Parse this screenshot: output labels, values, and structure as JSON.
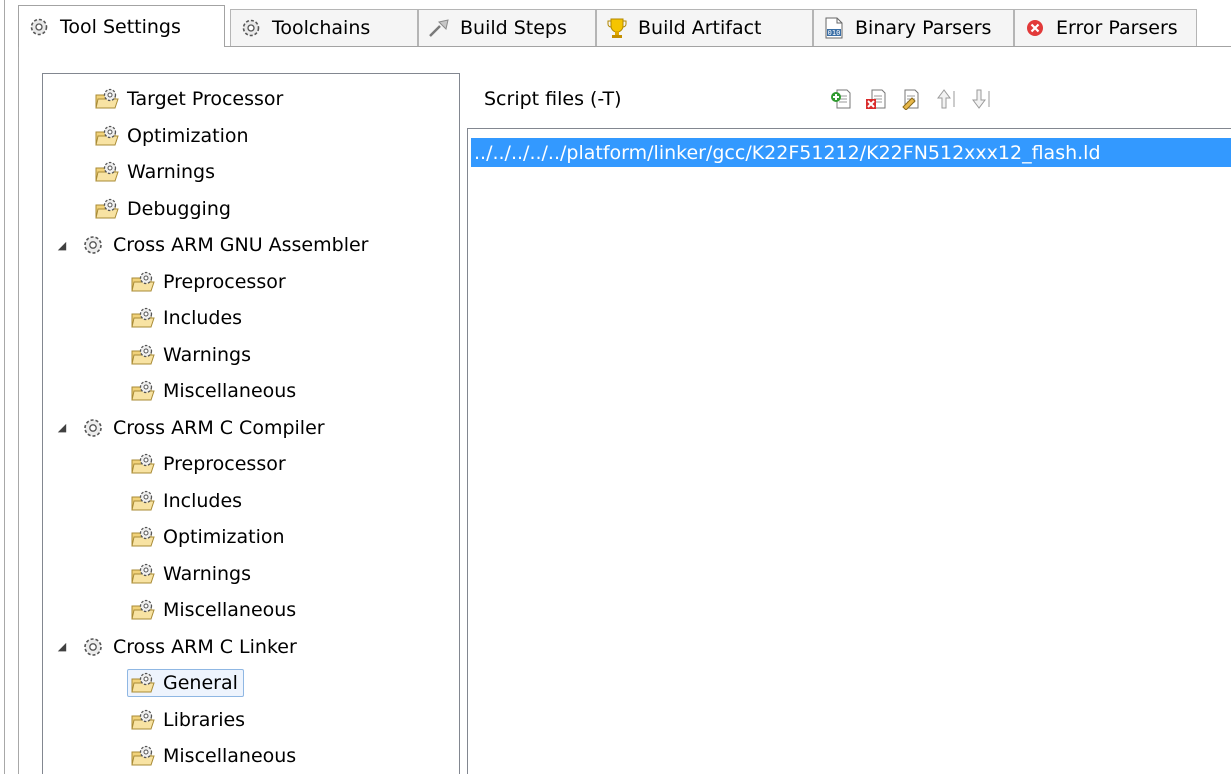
{
  "tabs": [
    {
      "label": "Tool Settings",
      "icon": "gear-icon",
      "active": true
    },
    {
      "label": "Toolchains",
      "icon": "gear-icon",
      "active": false
    },
    {
      "label": "Build Steps",
      "icon": "build-steps-icon",
      "active": false
    },
    {
      "label": "Build Artifact",
      "icon": "trophy-icon",
      "active": false
    },
    {
      "label": "Binary Parsers",
      "icon": "binary-file-icon",
      "active": false
    },
    {
      "label": "Error Parsers",
      "icon": "error-icon",
      "active": false
    }
  ],
  "tree": {
    "items": [
      {
        "label": "Target Processor",
        "icon": "option-folder-icon"
      },
      {
        "label": "Optimization",
        "icon": "option-folder-icon"
      },
      {
        "label": "Warnings",
        "icon": "option-folder-icon"
      },
      {
        "label": "Debugging",
        "icon": "option-folder-icon"
      },
      {
        "label": "Cross ARM GNU Assembler",
        "icon": "tool-gear-icon",
        "expanded": true
      },
      {
        "label": "Preprocessor",
        "icon": "option-folder-icon"
      },
      {
        "label": "Includes",
        "icon": "option-folder-icon"
      },
      {
        "label": "Warnings",
        "icon": "option-folder-icon"
      },
      {
        "label": "Miscellaneous",
        "icon": "option-folder-icon"
      },
      {
        "label": "Cross ARM C Compiler",
        "icon": "tool-gear-icon",
        "expanded": true
      },
      {
        "label": "Preprocessor",
        "icon": "option-folder-icon"
      },
      {
        "label": "Includes",
        "icon": "option-folder-icon"
      },
      {
        "label": "Optimization",
        "icon": "option-folder-icon"
      },
      {
        "label": "Warnings",
        "icon": "option-folder-icon"
      },
      {
        "label": "Miscellaneous",
        "icon": "option-folder-icon"
      },
      {
        "label": "Cross ARM C Linker",
        "icon": "tool-gear-icon",
        "expanded": true
      },
      {
        "label": "General",
        "icon": "option-folder-icon",
        "selected": true
      },
      {
        "label": "Libraries",
        "icon": "option-folder-icon"
      },
      {
        "label": "Miscellaneous",
        "icon": "option-folder-icon"
      }
    ]
  },
  "script_files": {
    "label": "Script files (-T)",
    "toolbar": [
      "add-icon",
      "delete-icon",
      "edit-icon",
      "move-up-icon",
      "move-down-icon"
    ],
    "entries": [
      "../../../../../platform/linker/gcc/K22F51212/K22FN512xxx12_flash.ld"
    ]
  },
  "colors": {
    "selection": "#3399ff",
    "selected_tree_item": "#eef4fd",
    "border": "#828790"
  }
}
